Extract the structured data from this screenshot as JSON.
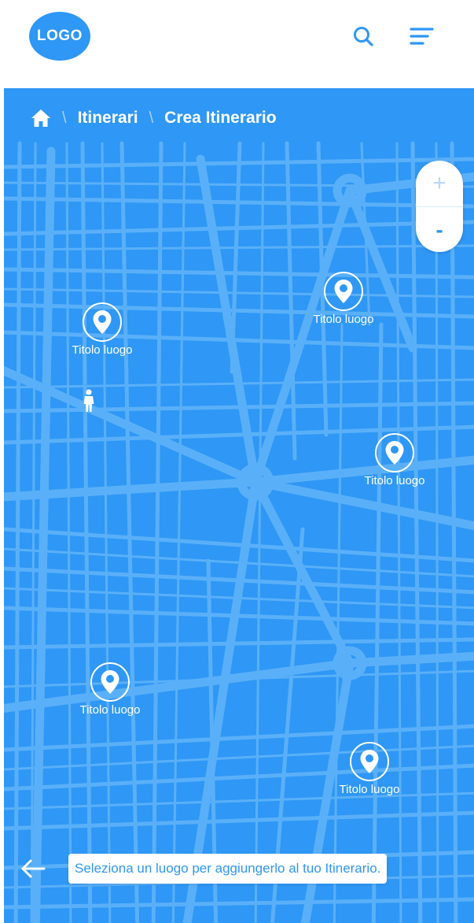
{
  "header": {
    "logo_text": "LOGO"
  },
  "breadcrumb": {
    "items": [
      "Itinerari",
      "Crea Itinerario"
    ]
  },
  "zoom": {
    "in_label": "+",
    "out_label": "-"
  },
  "places": [
    {
      "label": "Titolo luogo"
    },
    {
      "label": "Titolo luogo"
    },
    {
      "label": "Titolo luogo"
    },
    {
      "label": "Titolo luogo"
    },
    {
      "label": "Titolo luogo"
    }
  ],
  "hint": {
    "text": "Seleziona un luogo per aggiungerlo al tuo Itinerario."
  },
  "colors": {
    "primary": "#2f97f5",
    "streets": "#5ab0f8",
    "white": "#ffffff"
  }
}
